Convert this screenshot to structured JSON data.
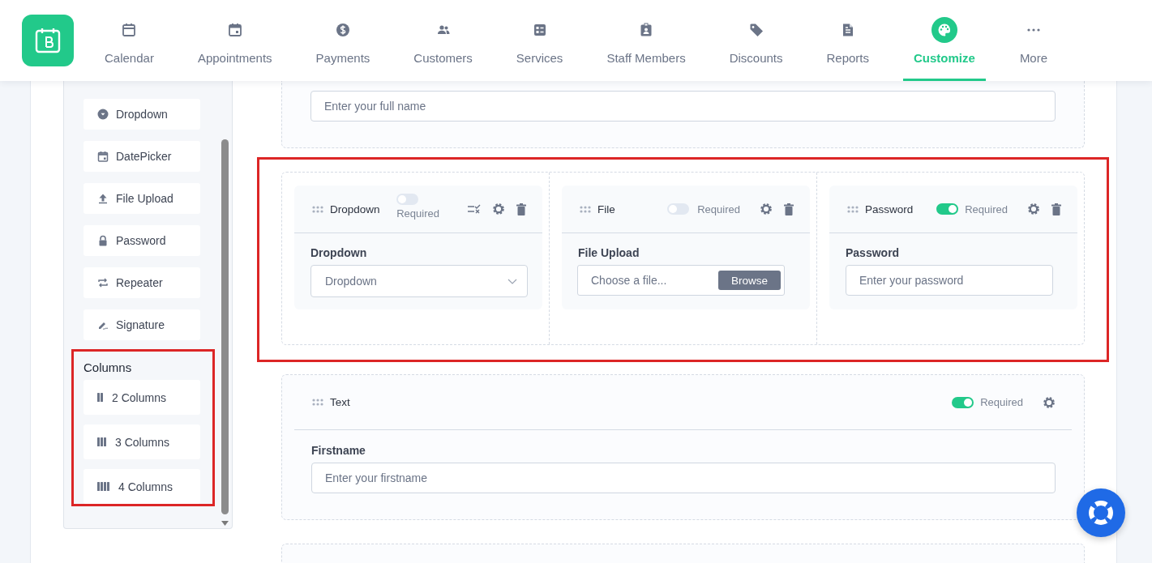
{
  "nav": [
    {
      "label": "Calendar",
      "selected": false
    },
    {
      "label": "Appointments",
      "selected": false
    },
    {
      "label": "Payments",
      "selected": false
    },
    {
      "label": "Customers",
      "selected": false
    },
    {
      "label": "Services",
      "selected": false
    },
    {
      "label": "Staff Members",
      "selected": false
    },
    {
      "label": "Discounts",
      "selected": false
    },
    {
      "label": "Reports",
      "selected": false
    },
    {
      "label": "Customize",
      "selected": true
    },
    {
      "label": "More",
      "selected": false
    }
  ],
  "sidebar": {
    "items": [
      "Dropdown",
      "DatePicker",
      "File Upload",
      "Password",
      "Repeater",
      "Signature"
    ],
    "columns_section": {
      "title": "Columns",
      "highlighted": true,
      "items": [
        "2 Columns",
        "3 Columns",
        "4 Columns"
      ]
    }
  },
  "fullname_field": {
    "placeholder": "Enter your full name"
  },
  "column_row": {
    "highlighted": true,
    "columns": [
      {
        "kind": "dropdown",
        "title": "Dropdown",
        "required": false,
        "required_label": "Required",
        "label": "Dropdown",
        "placeholder": "Dropdown"
      },
      {
        "kind": "file",
        "title": "File",
        "required": false,
        "required_label": "Required",
        "label": "File Upload",
        "placeholder": "Choose a file...",
        "button": "Browse"
      },
      {
        "kind": "password",
        "title": "Password",
        "required": true,
        "required_label": "Required",
        "label": "Password",
        "placeholder": "Enter your password"
      }
    ]
  },
  "text_field": {
    "title": "Text",
    "required": true,
    "required_label": "Required",
    "label": "Firstname",
    "placeholder": "Enter your firstname"
  }
}
